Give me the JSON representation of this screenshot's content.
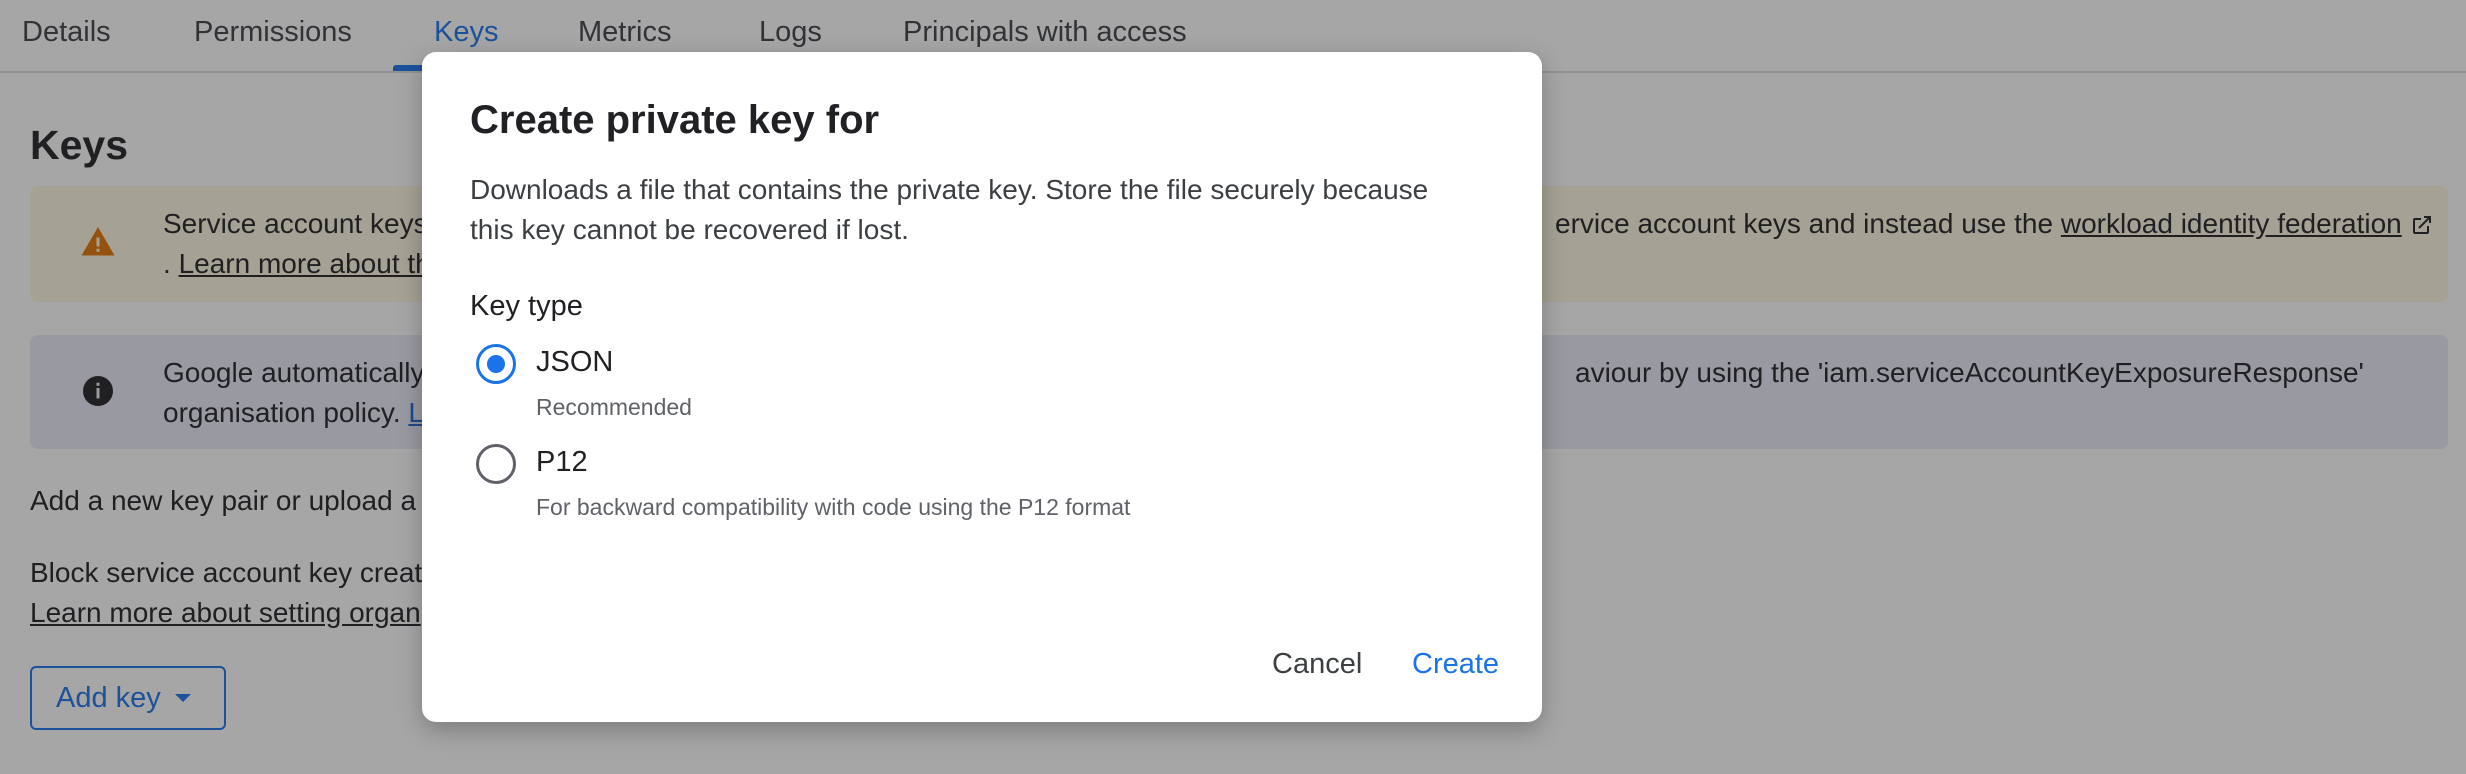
{
  "tabs": [
    {
      "label": "Details"
    },
    {
      "label": "Permissions"
    },
    {
      "label": "Keys"
    },
    {
      "label": "Metrics"
    },
    {
      "label": "Logs"
    },
    {
      "label": "Principals with access"
    }
  ],
  "active_tab": "Keys",
  "page": {
    "heading": "Keys",
    "warning_banner": {
      "icon": "warning-icon",
      "text_line1_start": "Service account keys",
      "text_line1_end": "ervice account keys and instead use the",
      "link_workload": "workload identity federation",
      "text_line2_prefix": ".",
      "link_learn_more": "Learn more about th"
    },
    "info_banner": {
      "icon": "info-icon",
      "text_line1_start": "Google automatically",
      "text_line1_end": "aviour by using the 'iam.serviceAccountKeyExposureResponse'",
      "text_line2": "organisation policy.",
      "link_partial": "L"
    },
    "add_key_text": "Add a new key pair or upload a p",
    "block_text": "Block service account key creat",
    "block_link": "Learn more about setting organ",
    "add_key_button": "Add key"
  },
  "dialog": {
    "title": "Create private key for",
    "description": "Downloads a file that contains the private key. Store the file securely because this key cannot be recovered if lost.",
    "key_type_label": "Key type",
    "options": [
      {
        "label": "JSON",
        "sublabel": "Recommended",
        "selected": true
      },
      {
        "label": "P12",
        "sublabel": "For backward compatibility with code using the P12 format",
        "selected": false
      }
    ],
    "cancel_label": "Cancel",
    "create_label": "Create"
  },
  "colors": {
    "accent": "#1a73e8",
    "warning_bg": "#fef7e0",
    "warning_icon": "#e37400",
    "info_bg": "#e8eaf6"
  }
}
